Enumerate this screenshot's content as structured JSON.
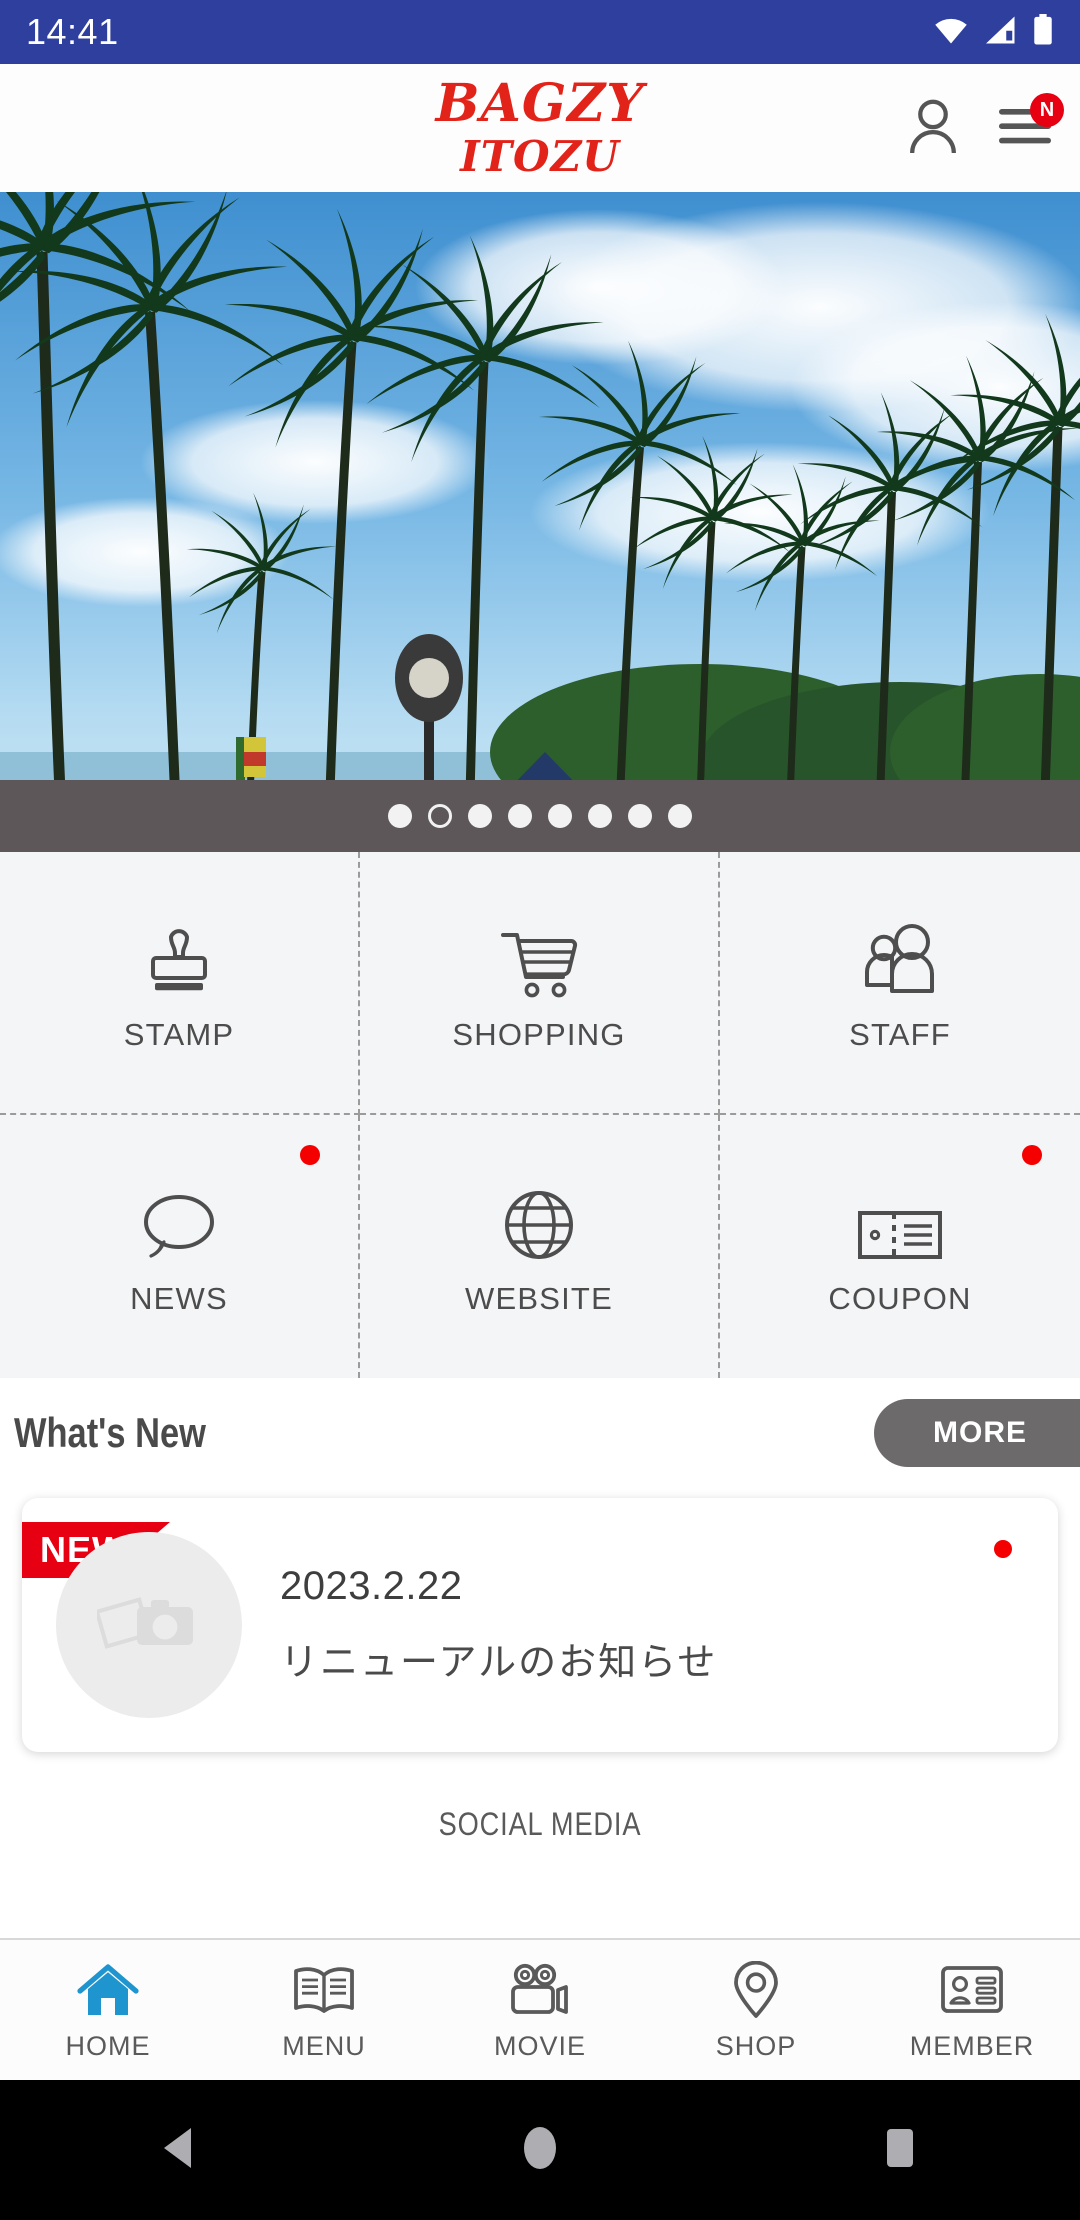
{
  "status_bar": {
    "time": "14:41",
    "icons": [
      "wifi-icon",
      "cellular-signal-icon",
      "battery-icon"
    ],
    "background": "#2e3f9e"
  },
  "header": {
    "logo_line1": "BAGZY",
    "logo_line2": "ITOZU",
    "logo_color": "#e2231a",
    "account_icon": "person-icon",
    "menu_icon": "hamburger-menu-icon",
    "menu_badge": "N",
    "badge_color": "#e60012"
  },
  "carousel": {
    "total_slides": 8,
    "current_slide": 2,
    "image_alt": "palm-trees-beach-photo",
    "dots_bar_color": "#5d575a"
  },
  "menu_grid": {
    "items": [
      {
        "label": "STAMP",
        "icon": "stamp-icon",
        "badge": false
      },
      {
        "label": "SHOPPING",
        "icon": "shopping-cart-icon",
        "badge": false
      },
      {
        "label": "STAFF",
        "icon": "people-icon",
        "badge": false
      },
      {
        "label": "NEWS",
        "icon": "speech-bubble-icon",
        "badge": true
      },
      {
        "label": "WEBSITE",
        "icon": "globe-icon",
        "badge": false
      },
      {
        "label": "COUPON",
        "icon": "ticket-icon",
        "badge": true
      }
    ],
    "badge_color": "#f40000"
  },
  "whats_new": {
    "title": "What's New",
    "more_label": "MORE",
    "more_color": "#6d6a6b",
    "items": [
      {
        "ribbon": "NEW",
        "ribbon_color": "#e60012",
        "date": "2023.2.22",
        "text": "リニューアルのお知らせ",
        "thumb_icon": "photo-placeholder-icon",
        "unread": true
      }
    ]
  },
  "social_media": {
    "heading": "SOCIAL MEDIA"
  },
  "tab_bar": {
    "active_index": 0,
    "active_color": "#1f95cf",
    "inactive_color": "#5a5a5a",
    "tabs": [
      {
        "label": "HOME",
        "icon": "home-icon"
      },
      {
        "label": "MENU",
        "icon": "open-book-icon"
      },
      {
        "label": "MOVIE",
        "icon": "video-camera-icon"
      },
      {
        "label": "SHOP",
        "icon": "location-pin-icon"
      },
      {
        "label": "MEMBER",
        "icon": "id-card-icon"
      }
    ]
  },
  "android_nav": {
    "back_icon": "back-triangle-icon",
    "home_icon": "home-circle-icon",
    "recents_icon": "recents-square-icon"
  }
}
